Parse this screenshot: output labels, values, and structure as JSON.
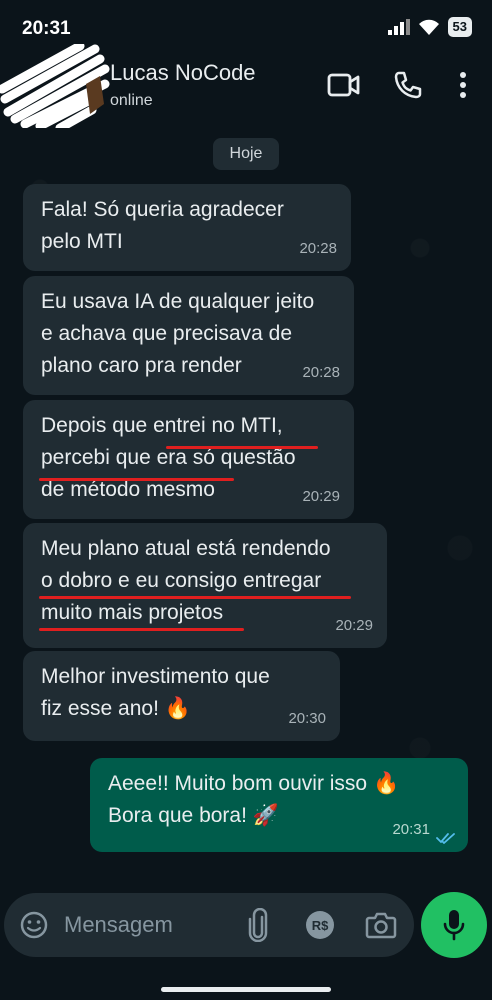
{
  "status_bar": {
    "time": "20:31",
    "battery": "53"
  },
  "header": {
    "contact_name": "Lucas NoCode",
    "contact_status": "online"
  },
  "chat": {
    "date_chip": "Hoje",
    "messages": [
      {
        "direction": "in",
        "text": "Fala! Só queria agradecer\npelo MTI",
        "time": "20:28"
      },
      {
        "direction": "in",
        "text": "Eu usava IA de qualquer jeito\ne achava que precisava de\nplano caro pra render",
        "time": "20:28"
      },
      {
        "direction": "in",
        "text": "Depois que entrei no MTI,\npercebi que era só questão\nde método mesmo",
        "time": "20:29"
      },
      {
        "direction": "in",
        "text": "Meu plano atual está rendendo\no dobro e eu consigo entregar\nmuito mais projetos",
        "time": "20:29"
      },
      {
        "direction": "in",
        "text": "Melhor investimento que\nfiz esse ano! 🔥",
        "time": "20:30"
      },
      {
        "direction": "out",
        "text": "Aeee!! Muito bom ouvir isso 🔥\nBora que bora! 🚀",
        "time": "20:31",
        "read": true
      }
    ]
  },
  "input": {
    "placeholder": "Mensagem"
  },
  "colors": {
    "background": "#0b141a",
    "incoming_bubble": "#202c33",
    "outgoing_bubble": "#005c4b",
    "accent": "#21c063",
    "highlight_underline": "#e01f1f",
    "read_ticks": "#53bdeb"
  },
  "icons": [
    "signal-icon",
    "wifi-icon",
    "video-call-icon",
    "phone-icon",
    "more-icon",
    "emoji-icon",
    "attach-icon",
    "payment-icon",
    "camera-icon",
    "mic-icon",
    "double-check-icon"
  ]
}
